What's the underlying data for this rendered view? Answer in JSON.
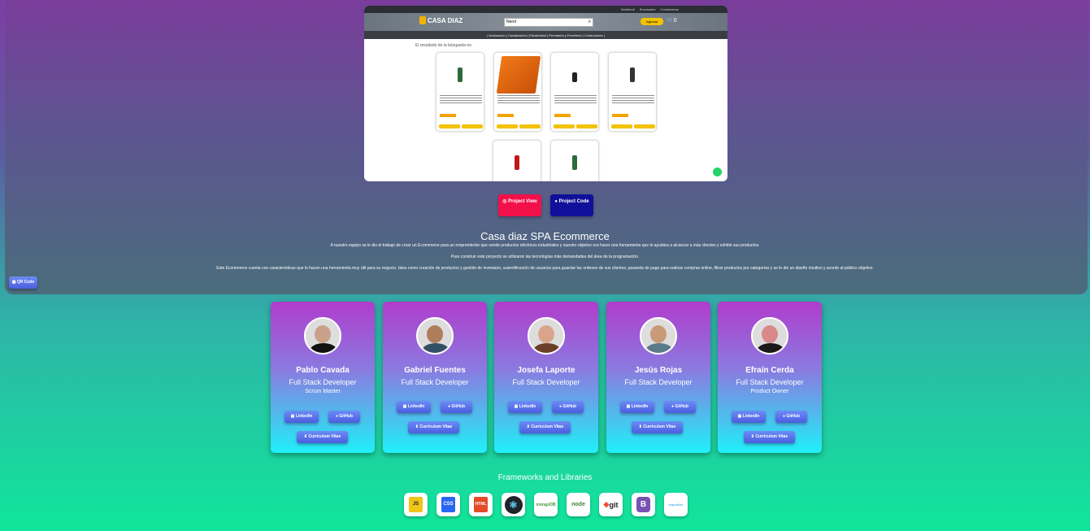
{
  "preview": {
    "topbar": [
      "Destitonit",
      "Sucursales",
      "Contactanos"
    ],
    "logo": "CASA DIAZ",
    "search_value": "Nerol",
    "login": "Ingresar",
    "cart_count": "0",
    "nav": "| Iluminación | Canalización | Electricidad | Pernatería y Ferretería | Conductores |",
    "result_text": "El resultado de la búsqueda es:"
  },
  "project": {
    "view_label": "Project View",
    "code_label": "Project Code",
    "title": "Casa diaz SPA Ecommerce",
    "desc1": "A nuestro equipo se le dio el trabajo de crear un Ecommerce para un emprendedor que vende productos eléctricos industriales y nuestro objetivo era hacer una herramienta que le ayudara a alcanzar a más clientes y exhibir sus productos.",
    "desc2": "Para construir este proyecto se utilizaron las tecnologías más demandadas del área de la programación.",
    "desc3": "Este Ecommerce cuenta con características que lo hacen una herramienta muy útil para su negocio, tales como creación de productos y gestión de inventario, autentificación de usuarios para guardar las ordenes de sus clientes, pasarela de pago para realizar compras online, filtrar productos por categorías y se le dio un diseño intuitivo y acorde al público objetivo.",
    "qr_label": "QR Code"
  },
  "team": [
    {
      "name": "Pablo Cavada",
      "role": "Full Stack Developer",
      "sub": "Scrum Master",
      "linkedin": "LinkedIn",
      "github": "GitHub",
      "cv": "Curriculum Vitae"
    },
    {
      "name": "Gabriel Fuentes",
      "role": "Full Stack Developer",
      "sub": "",
      "linkedin": "LinkedIn",
      "github": "GitHub",
      "cv": "Curriculum Vitae"
    },
    {
      "name": "Josefa Laporte",
      "role": "Full Stack Developer",
      "sub": "",
      "linkedin": "LinkedIn",
      "github": "GitHub",
      "cv": "Curriculum Vitae"
    },
    {
      "name": "Jesús Rojas",
      "role": "Full Stack Developer",
      "sub": "",
      "linkedin": "LinkedIn",
      "github": "GitHub",
      "cv": "Curriculum Vitae"
    },
    {
      "name": "Efraín Cerda",
      "role": "Full Stack Developer",
      "sub": "Product Owner",
      "linkedin": "LinkedIn",
      "github": "GitHub",
      "cv": "Curriculum Vitae"
    }
  ],
  "frameworks": {
    "title": "Frameworks and Libraries",
    "items": [
      "JS",
      "CSS",
      "HTML",
      "React",
      "mongoDB",
      "node",
      "git",
      "B",
      "sequelize"
    ]
  }
}
